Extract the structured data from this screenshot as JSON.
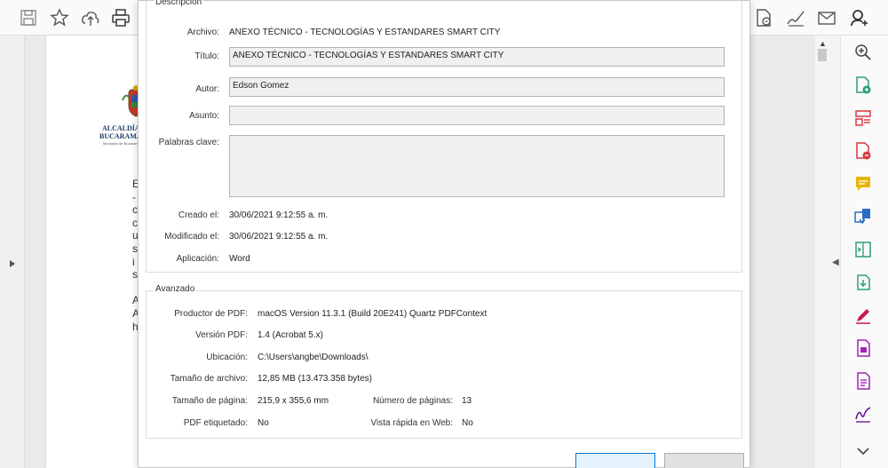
{
  "toolbar": {
    "left_icons": [
      "save-icon",
      "bookmark-star-icon",
      "upload-cloud-icon",
      "print-icon"
    ],
    "right_icons": [
      "export-pdf-icon",
      "sign-icon",
      "mail-icon",
      "share-user-icon"
    ]
  },
  "document": {
    "crest_label": "coat-of-arms",
    "alcaldia_line1": "ALCALDÍA D",
    "alcaldia_line2": "BUCARAMAN",
    "alcaldia_line3": "Municipio de Bucaram",
    "visible_letters": [
      "E",
      "-",
      "c",
      "c",
      "u",
      "s",
      "i",
      "s",
      "",
      "A",
      "A",
      "h"
    ]
  },
  "dialog": {
    "description_group_title": "Descripción",
    "advanced_group_title": "Avanzado",
    "description": {
      "archivo_label": "Archivo:",
      "archivo_value": "ANEXO TÉCNICO - TECNOLOGÍAS Y ESTANDARES SMART CITY",
      "titulo_label": "Título:",
      "titulo_value": "ANEXO TÉCNICO - TECNOLOGÍAS Y ESTANDARES SMART CITY",
      "autor_label": "Autor:",
      "autor_value": "Edson Gomez",
      "asunto_label": "Asunto:",
      "asunto_value": "",
      "palabras_label": "Palabras clave:",
      "palabras_value": "",
      "creado_label": "Creado el:",
      "creado_value": "30/06/2021 9:12:55 a. m.",
      "modificado_label": "Modificado el:",
      "modificado_value": "30/06/2021 9:12:55 a. m.",
      "aplicacion_label": "Aplicación:",
      "aplicacion_value": "Word"
    },
    "advanced": {
      "productor_label": "Productor de PDF:",
      "productor_value": "macOS Version 11.3.1 (Build 20E241) Quartz PDFContext",
      "version_label": "Versión PDF:",
      "version_value": "1.4 (Acrobat 5.x)",
      "ubicacion_label": "Ubicación:",
      "ubicacion_value": "C:\\Users\\angbe\\Downloads\\",
      "tamano_archivo_label": "Tamaño de archivo:",
      "tamano_archivo_value": "12,85 MB (13.473.358 bytes)",
      "tamano_pagina_label": "Tamaño de página:",
      "tamano_pagina_value": "215,9 x 355,6 mm",
      "num_paginas_label": "Número de páginas:",
      "num_paginas_value": "13",
      "etiquetado_label": "PDF etiquetado:",
      "etiquetado_value": "No",
      "vista_rapida_label": "Vista rápida en Web:",
      "vista_rapida_value": "No"
    }
  },
  "rail_icons": [
    "zoom-in-icon",
    "create-pdf-icon",
    "organize-pages-icon",
    "edit-pdf-icon",
    "comment-icon",
    "combine-files-icon",
    "compress-pdf-icon",
    "export-pdf-icon",
    "fill-sign-icon",
    "protect-icon",
    "optimize-pdf-icon",
    "signature-icon",
    "chevron-down-icon"
  ],
  "colors": {
    "accent_blue": "#0078d7",
    "adobe_red": "#d7373f",
    "adobe_green": "#2d9d78",
    "adobe_purple": "#9c27b0",
    "adobe_yellow": "#e8b500"
  }
}
